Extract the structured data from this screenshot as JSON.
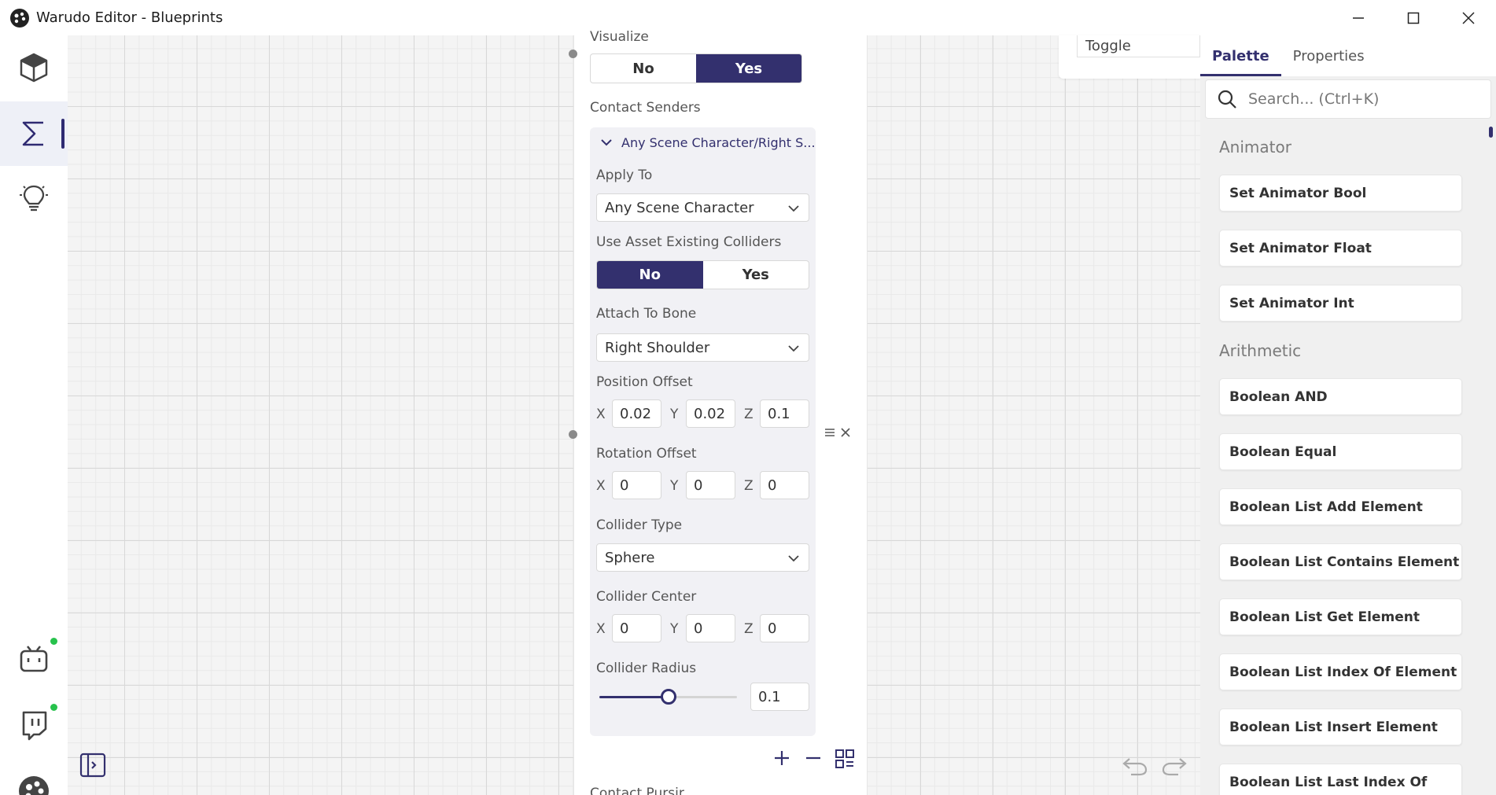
{
  "window": {
    "title": "Warudo Editor - Blueprints"
  },
  "rail": {
    "items": [
      "scene",
      "blueprints",
      "tips",
      "bilibili",
      "twitch",
      "warudo"
    ]
  },
  "node": {
    "visualize_label": "Visualize",
    "visualize_options": [
      "No",
      "Yes"
    ],
    "visualize_selected": "Yes",
    "contact_senders_label": "Contact Senders",
    "group_title": "Any Scene Character/Right S...",
    "apply_to_label": "Apply To",
    "apply_to_value": "Any Scene Character",
    "use_existing_label": "Use Asset Existing Colliders",
    "use_existing_options": [
      "No",
      "Yes"
    ],
    "use_existing_selected": "No",
    "attach_bone_label": "Attach To Bone",
    "attach_bone_value": "Right Shoulder",
    "position_offset_label": "Position Offset",
    "position_offset": {
      "x": "0.02",
      "y": "0.02",
      "z": "0.1"
    },
    "rotation_offset_label": "Rotation Offset",
    "rotation_offset": {
      "x": "0",
      "y": "0",
      "z": "0"
    },
    "collider_type_label": "Collider Type",
    "collider_type_value": "Sphere",
    "collider_center_label": "Collider Center",
    "collider_center": {
      "x": "0",
      "y": "0",
      "z": "0"
    },
    "collider_radius_label": "Collider Radius",
    "collider_radius_value": "0.1",
    "collider_radius_slider_fraction": 0.5,
    "axis_labels": {
      "x": "X",
      "y": "Y",
      "z": "Z"
    },
    "cut_off_label": "Contact Pursir"
  },
  "other_node": {
    "field_value": "Toggle"
  },
  "panel": {
    "tabs": [
      "Palette",
      "Properties"
    ],
    "active_tab": "Palette",
    "search_placeholder": "Search... (Ctrl+K)",
    "categories": [
      {
        "name": "Animator",
        "items": [
          "Set Animator Bool",
          "Set Animator Float",
          "Set Animator Int"
        ]
      },
      {
        "name": "Arithmetic",
        "items": [
          "Boolean AND",
          "Boolean Equal",
          "Boolean List Add Element",
          "Boolean List Contains Element",
          "Boolean List Get Element",
          "Boolean List Index Of Element",
          "Boolean List Insert Element",
          "Boolean List Last Index Of"
        ]
      }
    ]
  },
  "colors": {
    "accent": "#33306e",
    "canvas_bg": "#f4f4f4",
    "status_online": "#27c24c"
  }
}
